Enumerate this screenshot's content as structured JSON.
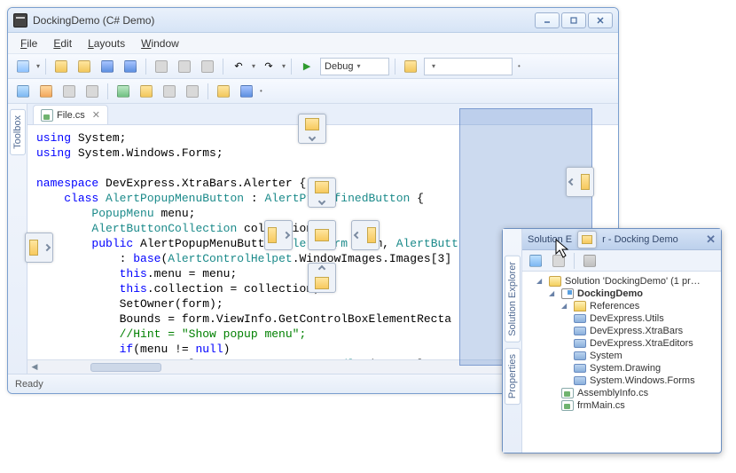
{
  "window": {
    "title": "DockingDemo (C# Demo)"
  },
  "menu": [
    "File",
    "Edit",
    "Layouts",
    "Window"
  ],
  "toolbar1": {
    "config_label": "Debug"
  },
  "tabs": {
    "file": "File.cs"
  },
  "sidebar": {
    "toolbox": "Toolbox"
  },
  "code_tokens": [
    [
      {
        "t": "kw",
        "v": "using"
      },
      {
        "t": "",
        "v": " System;"
      }
    ],
    [
      {
        "t": "kw",
        "v": "using"
      },
      {
        "t": "",
        "v": " System.Windows.Forms;"
      }
    ],
    [],
    [
      {
        "t": "kw",
        "v": "namespace"
      },
      {
        "t": "",
        "v": " DevExpress.XtraBars.Alerter {"
      }
    ],
    [
      {
        "t": "",
        "v": "    "
      },
      {
        "t": "kw",
        "v": "class"
      },
      {
        "t": "",
        "v": " "
      },
      {
        "t": "typ",
        "v": "AlertPopupMenuButton"
      },
      {
        "t": "",
        "v": " : "
      },
      {
        "t": "typ",
        "v": "AlertPredefinedButton"
      },
      {
        "t": "",
        "v": " {"
      }
    ],
    [
      {
        "t": "",
        "v": "        "
      },
      {
        "t": "typ",
        "v": "PopupMenu"
      },
      {
        "t": "",
        "v": " menu;"
      }
    ],
    [
      {
        "t": "",
        "v": "        "
      },
      {
        "t": "typ",
        "v": "AlertButtonCollection"
      },
      {
        "t": "",
        "v": " collection;"
      }
    ],
    [
      {
        "t": "",
        "v": "        "
      },
      {
        "t": "kw",
        "v": "public"
      },
      {
        "t": "",
        "v": " AlertPopupMenuButton("
      },
      {
        "t": "typ",
        "v": "AlertForm"
      },
      {
        "t": "",
        "v": " form, "
      },
      {
        "t": "typ",
        "v": "AlertButt"
      }
    ],
    [
      {
        "t": "",
        "v": "            : "
      },
      {
        "t": "kw",
        "v": "base"
      },
      {
        "t": "",
        "v": "("
      },
      {
        "t": "typ",
        "v": "AlertControlHelpet"
      },
      {
        "t": "",
        "v": ".WindowImages.Images[3]"
      }
    ],
    [
      {
        "t": "",
        "v": "            "
      },
      {
        "t": "kw",
        "v": "this"
      },
      {
        "t": "",
        "v": ".menu = menu;"
      }
    ],
    [
      {
        "t": "",
        "v": "            "
      },
      {
        "t": "kw",
        "v": "this"
      },
      {
        "t": "",
        "v": ".collection = collection;"
      }
    ],
    [
      {
        "t": "",
        "v": "            SetOwner(form);"
      }
    ],
    [
      {
        "t": "",
        "v": "            Bounds = form.ViewInfo.GetControlBoxElementRecta"
      }
    ],
    [
      {
        "t": "",
        "v": "            "
      },
      {
        "t": "cmt",
        "v": "//Hint = \"Show popup menu\";"
      }
    ],
    [
      {
        "t": "",
        "v": "            "
      },
      {
        "t": "kw",
        "v": "if"
      },
      {
        "t": "",
        "v": "(menu != "
      },
      {
        "t": "kw",
        "v": "null"
      },
      {
        "t": "",
        "v": ")"
      }
    ],
    [
      {
        "t": "",
        "v": "                menu.CloseUp += "
      },
      {
        "t": "kw",
        "v": "new"
      },
      {
        "t": "",
        "v": " "
      },
      {
        "t": "typ",
        "v": "EventHandler"
      },
      {
        "t": "",
        "v": "(menu_Close"
      }
    ]
  ],
  "status": "Ready",
  "float": {
    "title_left": "Solution E",
    "title_right": "r - Docking Demo",
    "left_tabs": [
      "Solution Explorer",
      "Properties"
    ],
    "tree": {
      "solution": "Solution 'DockingDemo' (1 pr…",
      "project": "DockingDemo",
      "references_label": "References",
      "references": [
        "DevExpress.Utils",
        "DevExpress.XtraBars",
        "DevExpress.XtraEditors",
        "System",
        "System.Drawing",
        "System.Windows.Forms"
      ],
      "files": [
        "AssemblyInfo.cs",
        "frmMain.cs"
      ]
    }
  }
}
